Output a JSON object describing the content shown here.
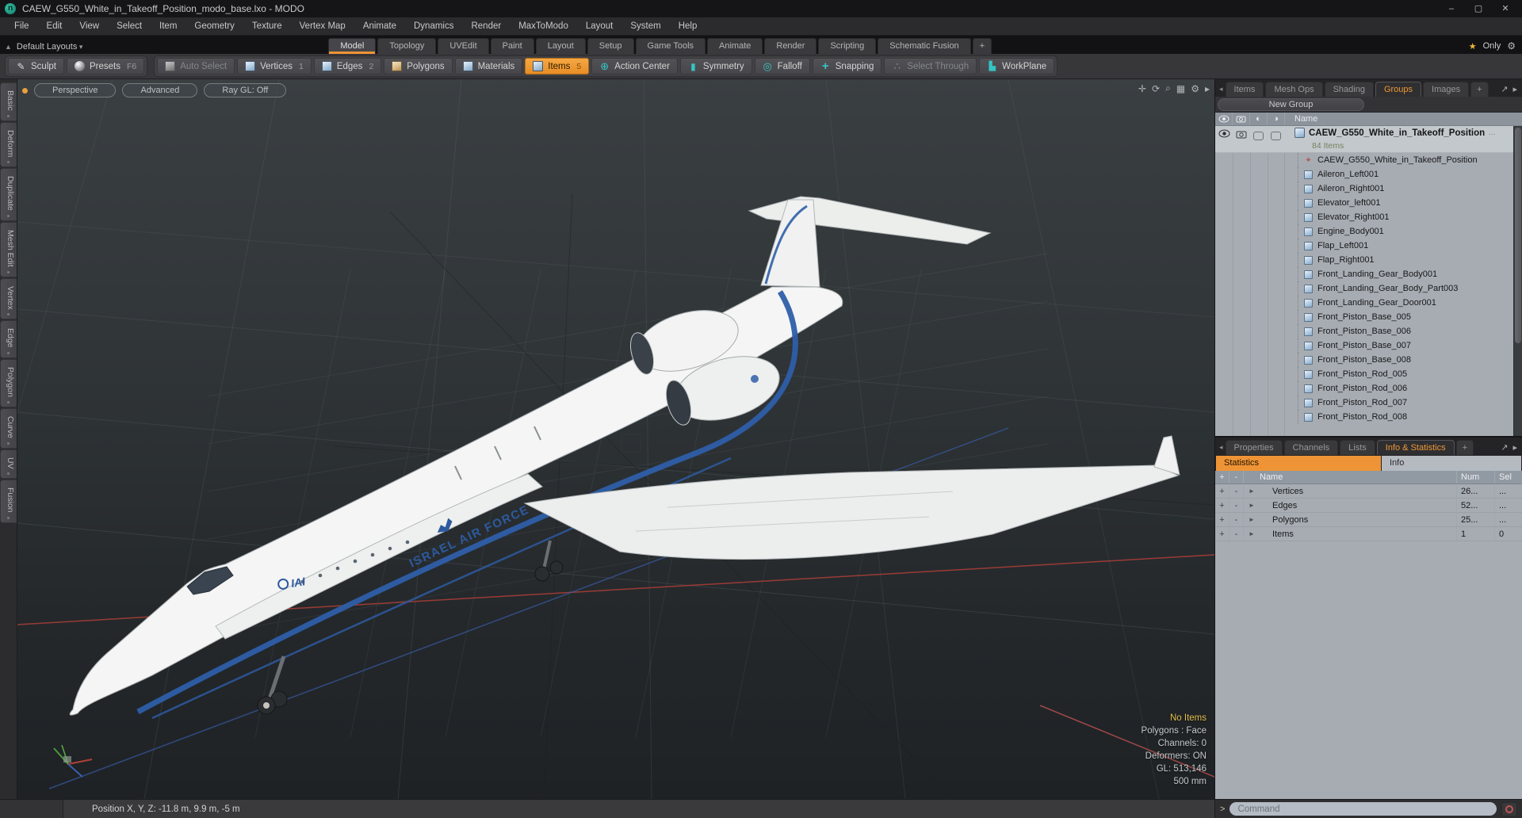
{
  "window": {
    "title": "CAEW_G550_White_in_Takeoff_Position_modo_base.lxo - MODO",
    "controls": {
      "minimize": "–",
      "maximize": "▢",
      "close": "✕"
    }
  },
  "menubar": [
    "File",
    "Edit",
    "View",
    "Select",
    "Item",
    "Geometry",
    "Texture",
    "Vertex Map",
    "Animate",
    "Dynamics",
    "Render",
    "MaxToModo",
    "Layout",
    "System",
    "Help"
  ],
  "layoutbar": {
    "preset_label": "Default Layouts",
    "tabs": [
      {
        "label": "Model",
        "state": "selected"
      },
      {
        "label": "Topology"
      },
      {
        "label": "UVEdit"
      },
      {
        "label": "Paint"
      },
      {
        "label": "Layout"
      },
      {
        "label": "Setup"
      },
      {
        "label": "Game Tools"
      },
      {
        "label": "Animate"
      },
      {
        "label": "Render"
      },
      {
        "label": "Scripting"
      },
      {
        "label": "Schematic Fusion"
      },
      {
        "label": "+",
        "state": "add"
      }
    ],
    "only_label": "Only"
  },
  "toolbar": {
    "left_buttons": [
      {
        "label": "Sculpt",
        "icon": "pen",
        "name": "sculpt-button"
      },
      {
        "label": "Presets",
        "badge": "F6",
        "icon": "sphere",
        "name": "presets-button"
      }
    ],
    "main_buttons": [
      {
        "label": "Auto Select",
        "icon": "cube-gray",
        "state": "disabled",
        "name": "auto-select-button"
      },
      {
        "label": "Vertices",
        "badge": "1",
        "icon": "cube-blue",
        "name": "vertices-button"
      },
      {
        "label": "Edges",
        "badge": "2",
        "icon": "cube-blue",
        "name": "edges-button"
      },
      {
        "label": "Polygons",
        "icon": "cube-tan",
        "name": "polygons-button"
      },
      {
        "label": "Materials",
        "icon": "cube-blue",
        "name": "materials-button"
      },
      {
        "label": "Items",
        "badge": "5",
        "icon": "cube-blue",
        "state": "selected",
        "name": "items-button"
      },
      {
        "label": "Action Center",
        "icon": "action-center",
        "name": "action-center-button"
      },
      {
        "label": "Symmetry",
        "icon": "symmetry",
        "name": "symmetry-button"
      },
      {
        "label": "Falloff",
        "icon": "falloff",
        "name": "falloff-button"
      },
      {
        "label": "Snapping",
        "icon": "snapping",
        "name": "snapping-button"
      },
      {
        "label": "Select Through",
        "icon": "select-through",
        "state": "disabled",
        "name": "select-through-button"
      },
      {
        "label": "WorkPlane",
        "icon": "workplane",
        "name": "workplane-button"
      }
    ]
  },
  "left_tabs": [
    "Basic",
    "Deform",
    "Duplicate",
    "Mesh Edit",
    "Vertex",
    "Edge",
    "Polygon",
    "Curve",
    "UV",
    "Fusion"
  ],
  "viewport": {
    "mode_buttons": [
      "Perspective",
      "Advanced",
      "Ray GL: Off"
    ],
    "overlay": [
      {
        "text": "No Items",
        "state": "warn"
      },
      {
        "text": "Polygons : Face"
      },
      {
        "text": "Channels: 0"
      },
      {
        "text": "Deformers: ON"
      },
      {
        "text": "GL: 513,146"
      },
      {
        "text": "500 mm"
      }
    ],
    "decals": {
      "airforce": "ISRAEL AIR FORCE",
      "logo": "IAI"
    }
  },
  "groups_panel": {
    "tabs": [
      {
        "label": "Items"
      },
      {
        "label": "Mesh Ops"
      },
      {
        "label": "Shading"
      },
      {
        "label": "Groups",
        "state": "selected"
      },
      {
        "label": "Images"
      },
      {
        "label": "+",
        "state": "add"
      }
    ],
    "new_group_label": "New Group",
    "name_header": "Name",
    "group": {
      "name": "CAEW_G550_White_in_Takeoff_Position",
      "count": "84 Items",
      "more": "..."
    },
    "items": [
      {
        "label": "CAEW_G550_White_in_Takeoff_Position",
        "icon": "locator"
      },
      {
        "label": "Aileron_Left001",
        "icon": "mesh"
      },
      {
        "label": "Aileron_Right001",
        "icon": "mesh"
      },
      {
        "label": "Elevator_left001",
        "icon": "mesh"
      },
      {
        "label": "Elevator_Right001",
        "icon": "mesh"
      },
      {
        "label": "Engine_Body001",
        "icon": "mesh"
      },
      {
        "label": "Flap_Left001",
        "icon": "mesh"
      },
      {
        "label": "Flap_Right001",
        "icon": "mesh"
      },
      {
        "label": "Front_Landing_Gear_Body001",
        "icon": "mesh"
      },
      {
        "label": "Front_Landing_Gear_Body_Part003",
        "icon": "mesh"
      },
      {
        "label": "Front_Landing_Gear_Door001",
        "icon": "mesh"
      },
      {
        "label": "Front_Piston_Base_005",
        "icon": "mesh"
      },
      {
        "label": "Front_Piston_Base_006",
        "icon": "mesh"
      },
      {
        "label": "Front_Piston_Base_007",
        "icon": "mesh"
      },
      {
        "label": "Front_Piston_Base_008",
        "icon": "mesh"
      },
      {
        "label": "Front_Piston_Rod_005",
        "icon": "mesh"
      },
      {
        "label": "Front_Piston_Rod_006",
        "icon": "mesh"
      },
      {
        "label": "Front_Piston_Rod_007",
        "icon": "mesh"
      },
      {
        "label": "Front_Piston_Rod_008",
        "icon": "mesh"
      }
    ]
  },
  "stats_panel": {
    "tabs": [
      {
        "label": "Properties"
      },
      {
        "label": "Channels"
      },
      {
        "label": "Lists"
      },
      {
        "label": "Info & Statistics",
        "state": "selected"
      },
      {
        "label": "+",
        "state": "add"
      }
    ],
    "subtabs": {
      "statistics": "Statistics",
      "info": "Info"
    },
    "header": {
      "plus": "+",
      "minus": "-",
      "name": "Name",
      "num": "Num",
      "sel": "Sel"
    },
    "row_controls": {
      "plus": "+",
      "minus": "-",
      "arrow": "►"
    },
    "rows": [
      {
        "name": "Vertices",
        "num": "26...",
        "sel": "..."
      },
      {
        "name": "Edges",
        "num": "52...",
        "sel": "..."
      },
      {
        "name": "Polygons",
        "num": "25...",
        "sel": "..."
      },
      {
        "name": "Items",
        "num": "1",
        "sel": "0"
      }
    ]
  },
  "statusbar": {
    "position": "Position X, Y, Z:   -11.8 m, 9.9 m, -5 m",
    "prompt": ">",
    "command_placeholder": "Command"
  }
}
